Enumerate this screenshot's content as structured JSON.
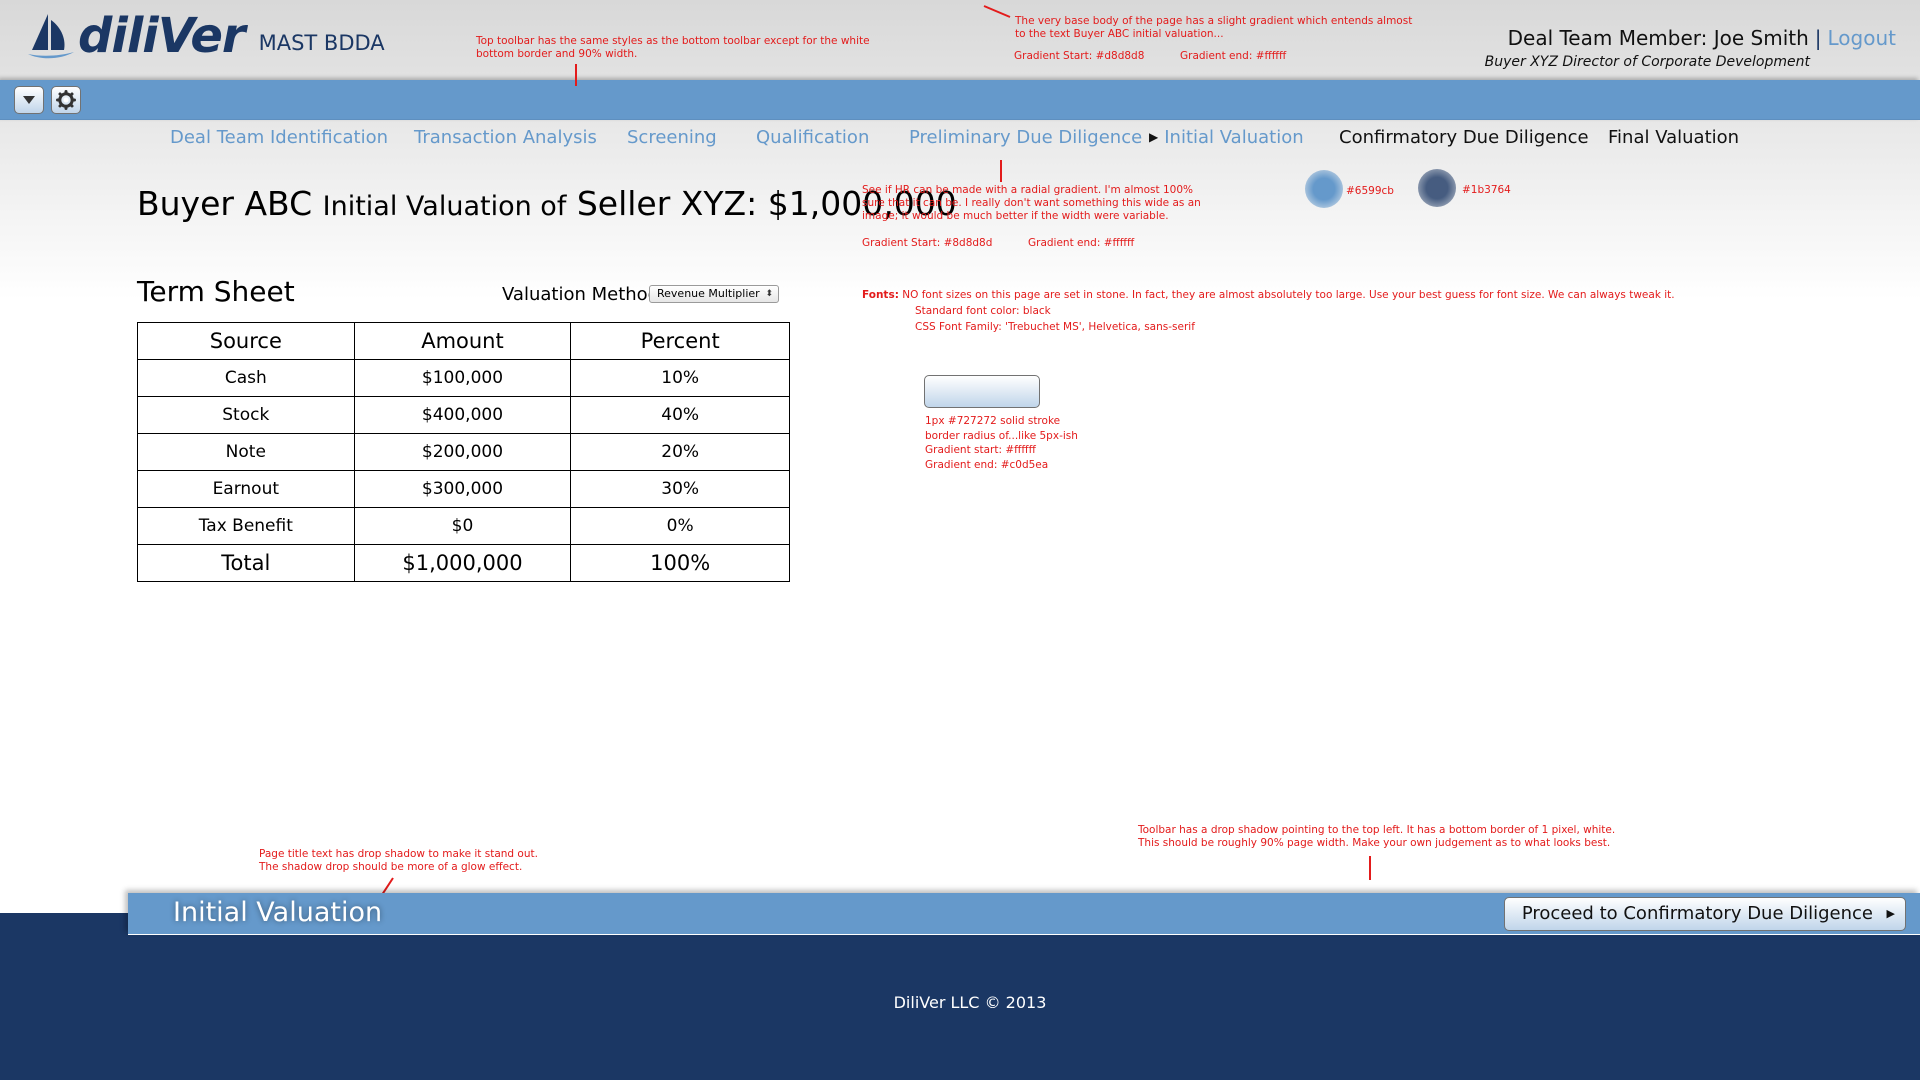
{
  "brand": {
    "word": "diliVer",
    "sub": "MAST BDDA"
  },
  "user": {
    "label": "Deal Team Member: Joe Smith",
    "separator": "|",
    "logout": "Logout",
    "role": "Buyer XYZ Director of Corporate Development"
  },
  "toolbar_icons": [
    "dropdown-icon",
    "gear-icon"
  ],
  "steps": [
    {
      "label": "Deal Team Identification"
    },
    {
      "label": "Transaction Analysis"
    },
    {
      "label": "Screening"
    },
    {
      "label": "Qualification"
    },
    {
      "label": "Preliminary Due Diligence"
    },
    {
      "label": "Initial Valuation",
      "current": true
    },
    {
      "label": "Confirmatory Due Diligence"
    },
    {
      "label": "Final Valuation"
    }
  ],
  "page_title": {
    "buyer": "Buyer ABC",
    "middle": "Initial Valuation of",
    "rest": "Seller XYZ: $1,000,000"
  },
  "term_sheet": {
    "title": "Term Sheet",
    "valuation_method_label": "Valuation Method",
    "valuation_method_value": "Revenue Multiplier",
    "headers": [
      "Source",
      "Amount",
      "Percent"
    ],
    "rows": [
      [
        "Cash",
        "$100,000",
        "10%"
      ],
      [
        "Stock",
        "$400,000",
        "40%"
      ],
      [
        "Note",
        "$200,000",
        "20%"
      ],
      [
        "Earnout",
        "$300,000",
        "30%"
      ],
      [
        "Tax Benefit",
        "$0",
        "0%"
      ]
    ],
    "total": [
      "Total",
      "$1,000,000",
      "100%"
    ]
  },
  "annotations": {
    "top_toolbar": [
      "Top toolbar has the same styles as the bottom toolbar except for the white",
      "bottom border and 90% width."
    ],
    "base_body": [
      "The very base body of the page has a slight gradient which entends almost",
      "to the text Buyer ABC initial valuation..."
    ],
    "base_gradient_start": "Gradient Start: #d8d8d8",
    "base_gradient_end": "Gradient end: #ffffff",
    "hr": [
      "See if HR can be made with a radial gradient. I'm almost 100%",
      "sure that it can be. I really don't want something this wide as an",
      "image; it would be much better if the width were variable."
    ],
    "hr_gradient_start": "Gradient Start: #8d8d8d",
    "hr_gradient_end": "Gradient end: #ffffff",
    "swatch1": "#6599cb",
    "swatch2": "#1b3764",
    "fonts_label": "Fonts:",
    "fonts": "NO font sizes on this page are set in stone. In fact, they are almost absolutely too large. Use your best guess for font size. We can always tweak it.",
    "fonts_color": "Standard font color: black",
    "fonts_family": "CSS Font Family: 'Trebuchet MS', Helvetica, sans-serif",
    "button": [
      "1px #727272 solid stroke",
      "border radius of...like 5px-ish",
      "Gradient start: #ffffff",
      "Gradient end: #c0d5ea"
    ],
    "page_title_shadow": [
      "Page title text has drop shadow to make it stand out.",
      "The shadow drop should be more of a glow effect."
    ],
    "toolbar_shadow": [
      "Toolbar has a drop shadow pointing to the top left. It has a bottom border of 1 pixel, white.",
      "This should be roughly 90% page width. Make your own judgement as to what looks best."
    ]
  },
  "bottom_toolbar": {
    "title": "Initial Valuation",
    "proceed": "Proceed to Confirmatory Due Diligence"
  },
  "footer": {
    "copyright": "DiliVer LLC © 2013"
  },
  "colors": {
    "toolbar_blue": "#6599cb",
    "footer_navy": "#1b3764",
    "annotation_red": "#e31b1b",
    "button_gradient_start": "#ffffff",
    "button_gradient_end": "#c0d5ea"
  }
}
